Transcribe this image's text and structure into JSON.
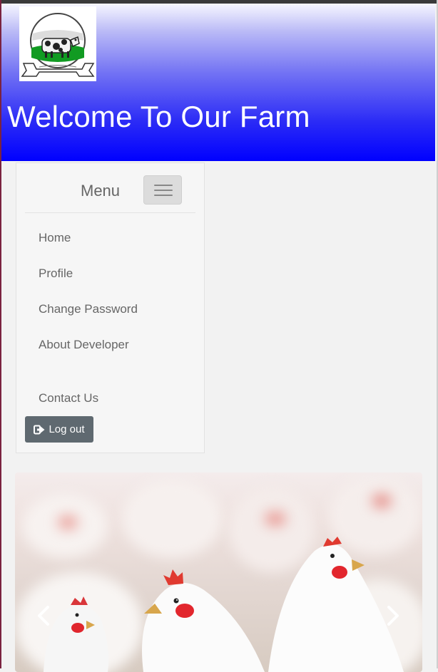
{
  "header": {
    "title": "Welcome To Our Farm",
    "gradient": [
      "#f7f7ff",
      "#0000ff"
    ],
    "logo_icon": "cow-logo-icon"
  },
  "menu": {
    "label": "Menu",
    "toggle_icon": "hamburger-icon",
    "items": [
      {
        "label": "Home"
      },
      {
        "label": "Profile"
      },
      {
        "label": "Change Password"
      },
      {
        "label": "About Developer"
      },
      {
        "label": "Contact Us"
      }
    ],
    "logout": {
      "label": "Log out",
      "icon": "logout-icon",
      "color": "#5f6970"
    }
  },
  "carousel": {
    "prev_icon": "chevron-left-icon",
    "next_icon": "chevron-right-icon",
    "image_subject": "chickens"
  }
}
